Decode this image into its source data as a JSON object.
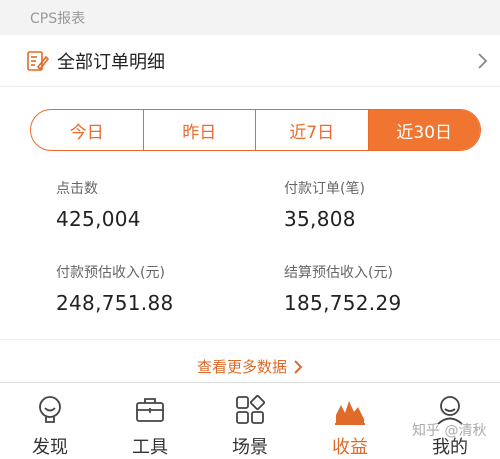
{
  "section_header": "CPS报表",
  "orders_row": {
    "label": "全部订单明细"
  },
  "tabs": [
    {
      "label": "今日",
      "active": false
    },
    {
      "label": "昨日",
      "active": false
    },
    {
      "label": "近7日",
      "active": false
    },
    {
      "label": "近30日",
      "active": true
    }
  ],
  "stats": {
    "clicks": {
      "title": "点击数",
      "value": "425,004"
    },
    "paid_orders": {
      "title": "付款订单(笔)",
      "value": "35,808"
    },
    "paid_est_income": {
      "title": "付款预估收入(元)",
      "value": "248,751.88"
    },
    "settled_est_income": {
      "title": "结算预估收入(元)",
      "value": "185,752.29"
    }
  },
  "more_link": "查看更多数据",
  "tabbar": [
    {
      "label": "发现",
      "icon": "bulb-icon",
      "active": false
    },
    {
      "label": "工具",
      "icon": "toolbox-icon",
      "active": false
    },
    {
      "label": "场景",
      "icon": "grid-icon",
      "active": false
    },
    {
      "label": "收益",
      "icon": "chart-icon",
      "active": true
    },
    {
      "label": "我的",
      "icon": "person-icon",
      "active": false
    }
  ],
  "watermark": "知乎 @清秋",
  "colors": {
    "accent": "#f07530",
    "accent_text": "#e06a28"
  }
}
